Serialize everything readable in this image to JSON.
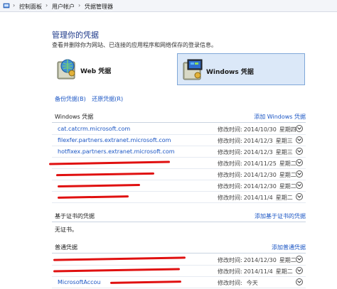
{
  "breadcrumb": {
    "items": [
      "控制面板",
      "用户帐户",
      "凭据管理器"
    ],
    "separator": "›"
  },
  "header": {
    "title": "管理你的凭据",
    "subtitle": "查看并删除你为网站、已连接的应用程序和网络保存的登录信息。"
  },
  "vaults": {
    "web_label": "Web 凭据",
    "windows_label": "Windows 凭据"
  },
  "actions": {
    "backup": "备份凭据(B)",
    "restore": "还原凭据(R)"
  },
  "windows_section": {
    "title": "Windows 凭据",
    "add": "添加 Windows 凭据",
    "rows": [
      {
        "address": "cat.catcrm.microsoft.com",
        "modified_label": "修改时间:",
        "date": "2014/10/30",
        "day": "星期四"
      },
      {
        "address": "filexfer.partners.extranet.microsoft.com",
        "modified_label": "修改时间:",
        "date": "2014/12/3",
        "day": "星期三"
      },
      {
        "address": "hotfixex.partners.extranet.microsoft.com",
        "modified_label": "修改时间:",
        "date": "2014/12/3",
        "day": "星期三"
      },
      {
        "address": "",
        "modified_label": "修改时间:",
        "date": "2014/11/25",
        "day": "星期二"
      },
      {
        "address": "",
        "modified_label": "修改时间:",
        "date": "2014/12/30",
        "day": "星期二"
      },
      {
        "address": "",
        "modified_label": "修改时间:",
        "date": "2014/12/30",
        "day": "星期二"
      },
      {
        "address": "",
        "modified_label": "修改时间:",
        "date": "2014/11/4",
        "day": "星期二"
      }
    ]
  },
  "cert_section": {
    "title": "基于证书的凭据",
    "add": "添加基于证书的凭据",
    "empty": "无证书。"
  },
  "generic_section": {
    "title": "普通凭据",
    "add": "添加普通凭据",
    "rows": [
      {
        "address": "",
        "modified_label": "修改时间:",
        "date": "2014/12/30",
        "day": "星期二"
      },
      {
        "address": "",
        "modified_label": "修改时间:",
        "date": "2014/11/4",
        "day": "星期二"
      },
      {
        "address": "MicrosoftAccou",
        "modified_label": "修改时间:",
        "date": "",
        "day": "今天"
      }
    ]
  },
  "colors": {
    "link": "#1a55c4",
    "selected_bg": "#dbe8f8",
    "redaction": "#e01010"
  },
  "icons": [
    "home-icon",
    "web-credential-vault-icon",
    "windows-credential-vault-icon",
    "chevron-down-icon"
  ]
}
